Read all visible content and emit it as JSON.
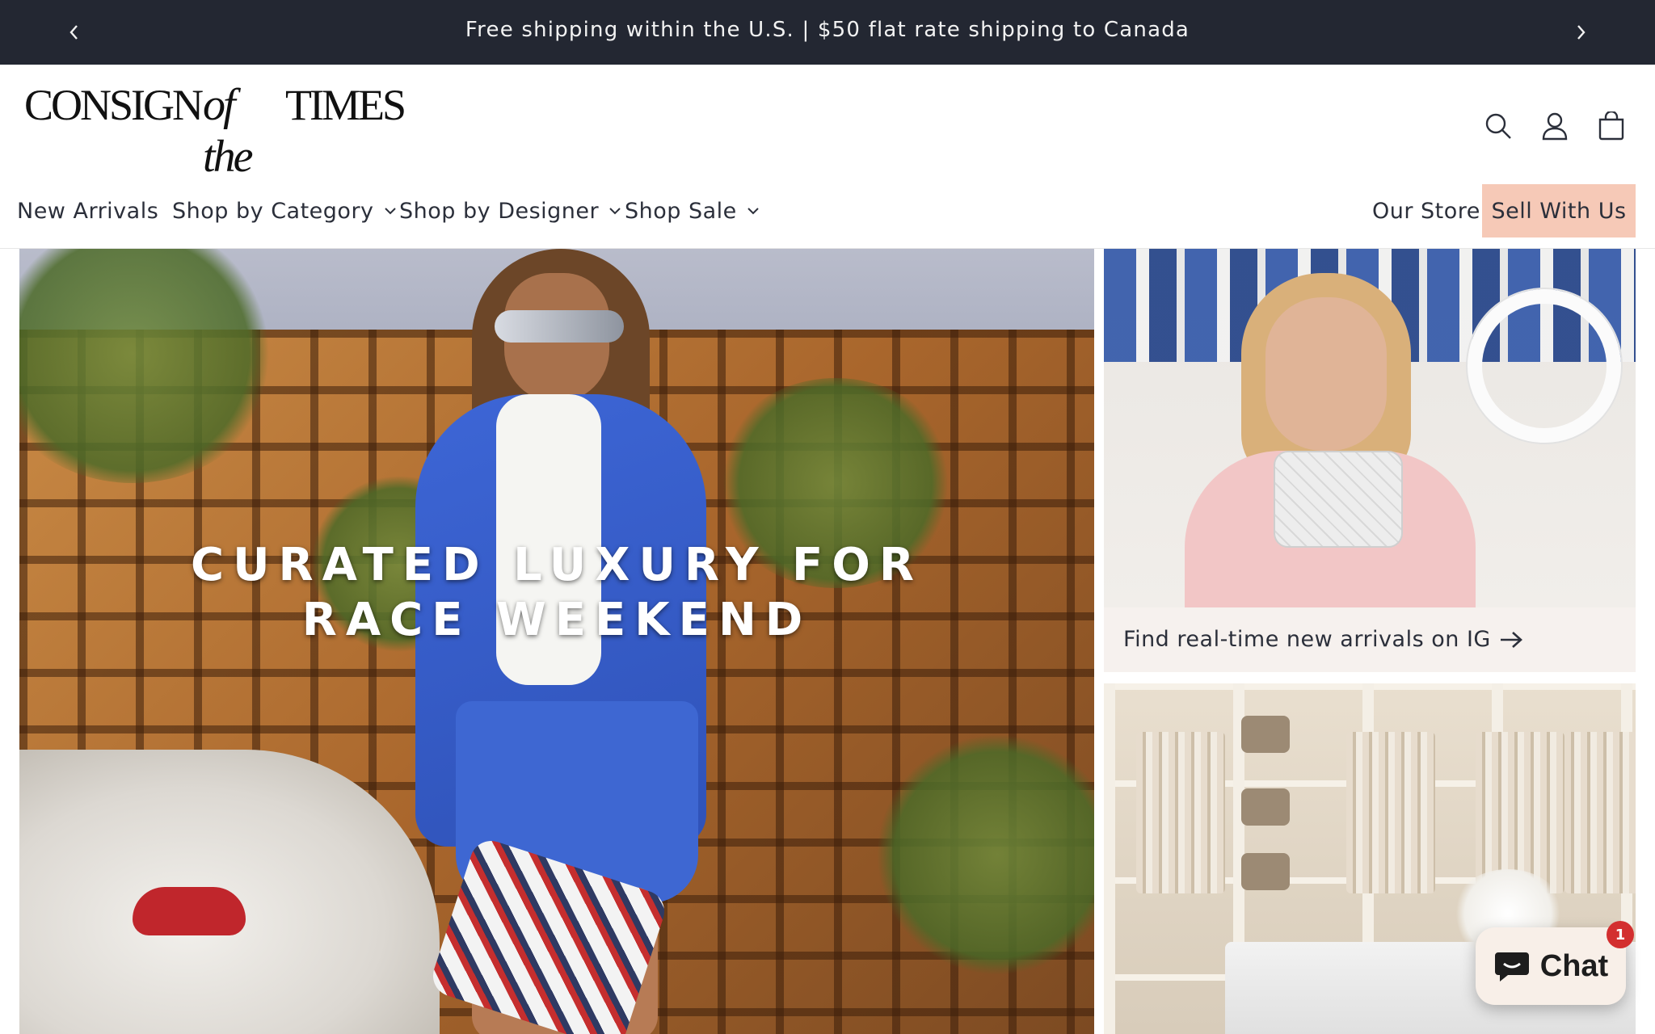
{
  "announcement": {
    "message": "Free shipping within the U.S. | $50 flat rate shipping to Canada",
    "prev_icon": "chevron-left-icon",
    "next_icon": "chevron-right-icon"
  },
  "brand": {
    "logo_part1": "CONSIGN",
    "logo_part2": "of the",
    "logo_part3": "TIMES"
  },
  "header_icons": {
    "search": "search-icon",
    "account": "account-icon",
    "cart": "cart-icon"
  },
  "nav": {
    "items": [
      {
        "label": "New Arrivals",
        "has_dropdown": false
      },
      {
        "label": "Shop by Category",
        "has_dropdown": true
      },
      {
        "label": "Shop by Designer",
        "has_dropdown": true
      },
      {
        "label": "Shop Sale",
        "has_dropdown": true
      }
    ],
    "our_store": "Our Store",
    "sell_with_us": "Sell With Us"
  },
  "hero": {
    "headline_line1": "CURATED LUXURY FOR",
    "headline_line2": "RACE WEEKEND"
  },
  "cards": {
    "ig_caption": "Find real-time new arrivals on IG"
  },
  "chat": {
    "label": "Chat",
    "badge_count": "1"
  },
  "colors": {
    "announcement_bg": "#232732",
    "sell_button_bg": "#f6c9b7",
    "caption_bg": "#f6f1ee",
    "chat_bg": "#f8efe8",
    "badge_bg": "#d32f2f"
  }
}
